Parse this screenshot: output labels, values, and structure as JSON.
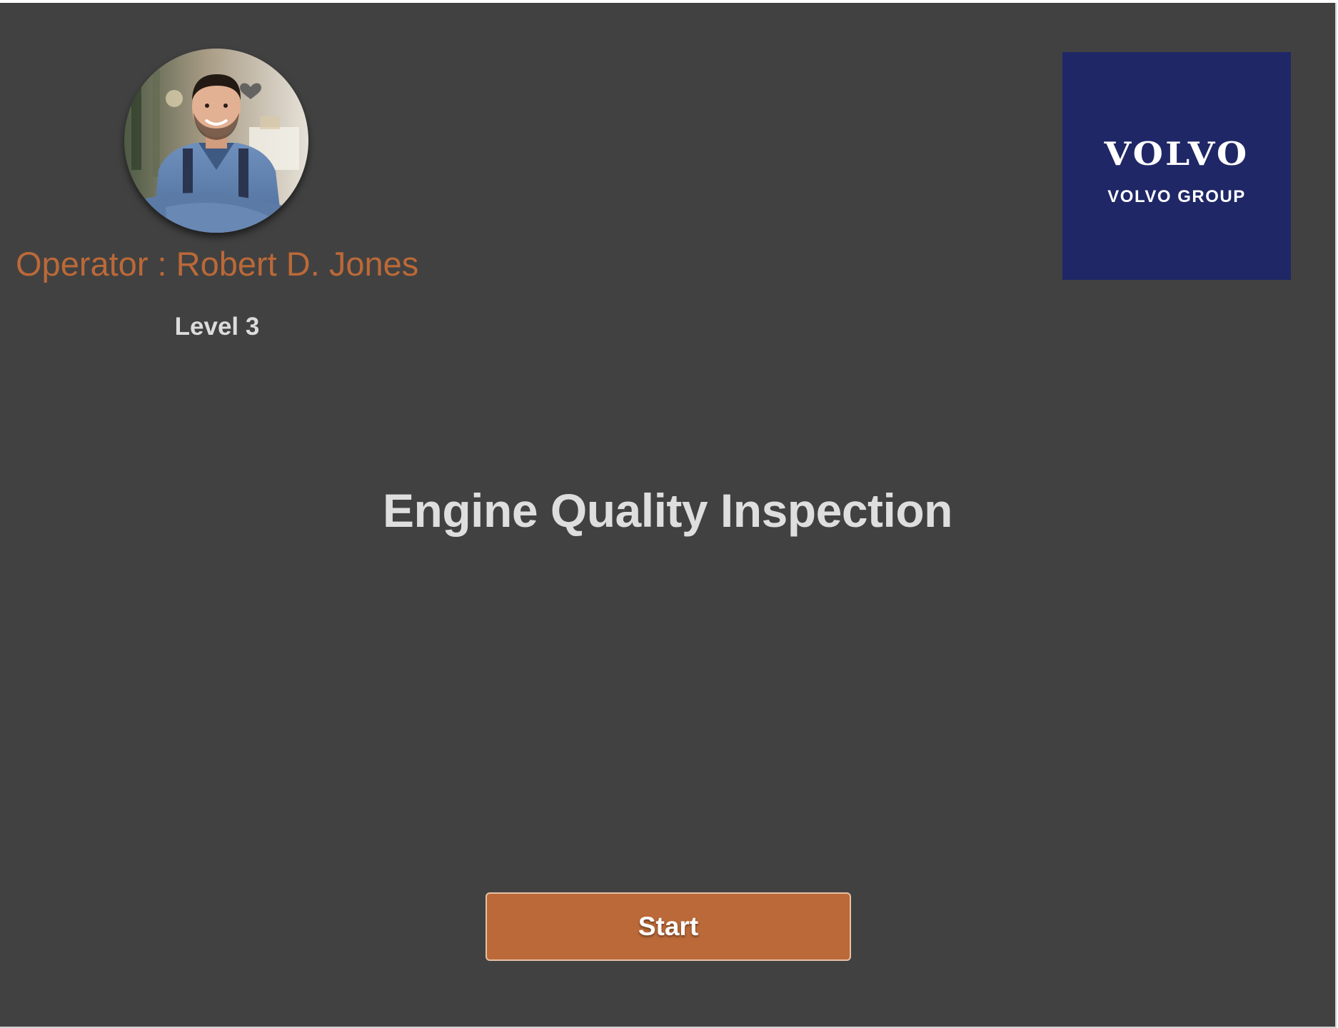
{
  "colors": {
    "background": "#414141",
    "accent": "#bb6938",
    "brand_navy": "#1f2766",
    "text_light": "#dedede"
  },
  "operator": {
    "name_label": "Operator : Robert D. Jones",
    "level": "Level 3",
    "avatar_icon": "heart-icon"
  },
  "logo": {
    "wordmark": "VOLVO",
    "group": "VOLVO GROUP"
  },
  "main": {
    "title": "Engine Quality Inspection"
  },
  "actions": {
    "start_label": "Start"
  }
}
